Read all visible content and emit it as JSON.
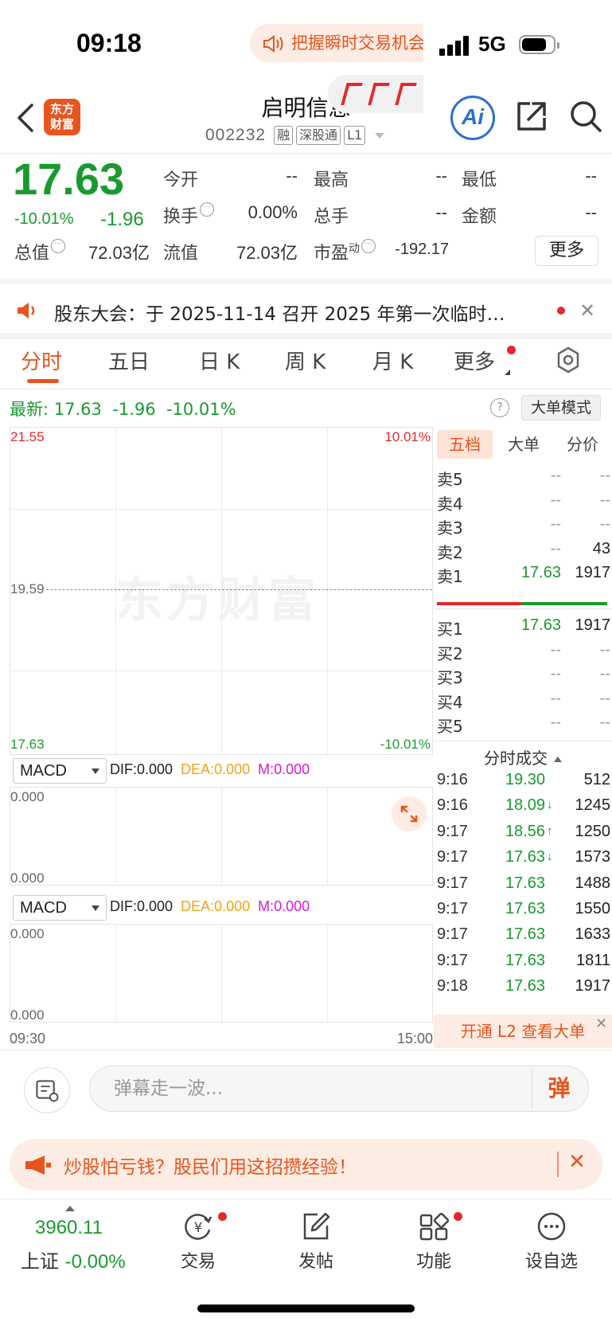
{
  "status_bar": {
    "time": "09:18",
    "network": "5G"
  },
  "header": {
    "brand_logo": "东方财富",
    "stock_name": "启明信息",
    "stock_code": "002232",
    "tags": [
      "融",
      "深股通",
      "L1"
    ],
    "ai_label": "Ai"
  },
  "quote": {
    "price": "17.63",
    "change_pct": "-10.01%",
    "change_abs": "-1.96",
    "open_label": "今开",
    "open_value": "--",
    "high_label": "最高",
    "high_value": "--",
    "low_label": "最低",
    "low_value": "--",
    "turnover_label": "换手",
    "turnover_value": "0.00%",
    "volume_label": "总手",
    "volume_value": "--",
    "amount_label": "金额",
    "amount_value": "--",
    "mktcap_label": "总值",
    "mktcap_value": "72.03亿",
    "float_label": "流值",
    "float_value": "72.03亿",
    "pe_label": "市盈",
    "pe_superscript": "动",
    "pe_value": "-192.17",
    "more_label": "更多"
  },
  "notice": {
    "text": "股东大会：于 2025-11-14 召开 2025 年第一次临时…"
  },
  "tabs": [
    {
      "label": "分时",
      "active": true
    },
    {
      "label": "五日"
    },
    {
      "label": "日 K"
    },
    {
      "label": "周 K"
    },
    {
      "label": "月 K"
    },
    {
      "label": "更多"
    }
  ],
  "latest": {
    "label": "最新:",
    "price": "17.63",
    "change": "-1.96",
    "pct": "-10.01%"
  },
  "bigorder_mode_label": "大单模式",
  "chart": {
    "y_top": "21.55",
    "y_mid": "19.59",
    "y_bottom": "17.63",
    "pct_top": "10.01%",
    "pct_bottom": "-10.01%",
    "watermark": "东方财富",
    "promo_text": "把握瞬时交易机会",
    "time_start": "09:30",
    "time_end": "15:00",
    "colors": {
      "up": "#e8262b",
      "down": "#1a9a2e",
      "accent": "#e8541e"
    }
  },
  "indicators": [
    {
      "name": "MACD",
      "dif": "DIF:0.000",
      "dea": "DEA:0.000",
      "m": "M:0.000",
      "y_top": "0.000",
      "y_bottom": "0.000"
    },
    {
      "name": "MACD",
      "dif": "DIF:0.000",
      "dea": "DEA:0.000",
      "m": "M:0.000",
      "y_top": "0.000",
      "y_bottom": "0.000"
    }
  ],
  "orderbook": {
    "tabs": [
      "五档",
      "大单",
      "分价"
    ],
    "asks": [
      {
        "label": "卖5",
        "price": "--",
        "vol": "--"
      },
      {
        "label": "卖4",
        "price": "--",
        "vol": "--"
      },
      {
        "label": "卖3",
        "price": "--",
        "vol": "--"
      },
      {
        "label": "卖2",
        "price": "--",
        "vol": "43"
      },
      {
        "label": "卖1",
        "price": "17.63",
        "vol": "1917"
      }
    ],
    "bids": [
      {
        "label": "买1",
        "price": "17.63",
        "vol": "1917"
      },
      {
        "label": "买2",
        "price": "--",
        "vol": "--"
      },
      {
        "label": "买3",
        "price": "--",
        "vol": "--"
      },
      {
        "label": "买4",
        "price": "--",
        "vol": "--"
      },
      {
        "label": "买5",
        "price": "--",
        "vol": "--"
      }
    ],
    "ticks_title": "分时成交",
    "ticks": [
      {
        "time": "9:16",
        "price": "19.30",
        "dir": "",
        "vol": "512"
      },
      {
        "time": "9:16",
        "price": "18.09",
        "dir": "↓",
        "vol": "1245"
      },
      {
        "time": "9:17",
        "price": "18.56",
        "dir": "↑",
        "vol": "1250"
      },
      {
        "time": "9:17",
        "price": "17.63",
        "dir": "↓",
        "vol": "1573"
      },
      {
        "time": "9:17",
        "price": "17.63",
        "dir": "",
        "vol": "1488"
      },
      {
        "time": "9:17",
        "price": "17.63",
        "dir": "",
        "vol": "1550"
      },
      {
        "time": "9:17",
        "price": "17.63",
        "dir": "",
        "vol": "1633"
      },
      {
        "time": "9:17",
        "price": "17.63",
        "dir": "",
        "vol": "1811"
      },
      {
        "time": "9:18",
        "price": "17.63",
        "dir": "",
        "vol": "1917"
      }
    ],
    "l2_label": "开通 L2 查看大单"
  },
  "comment": {
    "placeholder": "弹幕走一波...",
    "danmu_label": "弹"
  },
  "promo_banner": {
    "text": "炒股怕亏钱？股民们用这招攒经验！"
  },
  "bottom_nav": {
    "index_value": "3960.11",
    "index_name": "上证",
    "index_change": "-0.00%",
    "items": [
      {
        "label": "交易",
        "icon": "yuan-exchange-icon",
        "dot": true
      },
      {
        "label": "发帖",
        "icon": "edit-icon",
        "dot": false
      },
      {
        "label": "功能",
        "icon": "grid-icon",
        "dot": true
      },
      {
        "label": "设自选",
        "icon": "more-dots-icon",
        "dot": false
      }
    ]
  }
}
